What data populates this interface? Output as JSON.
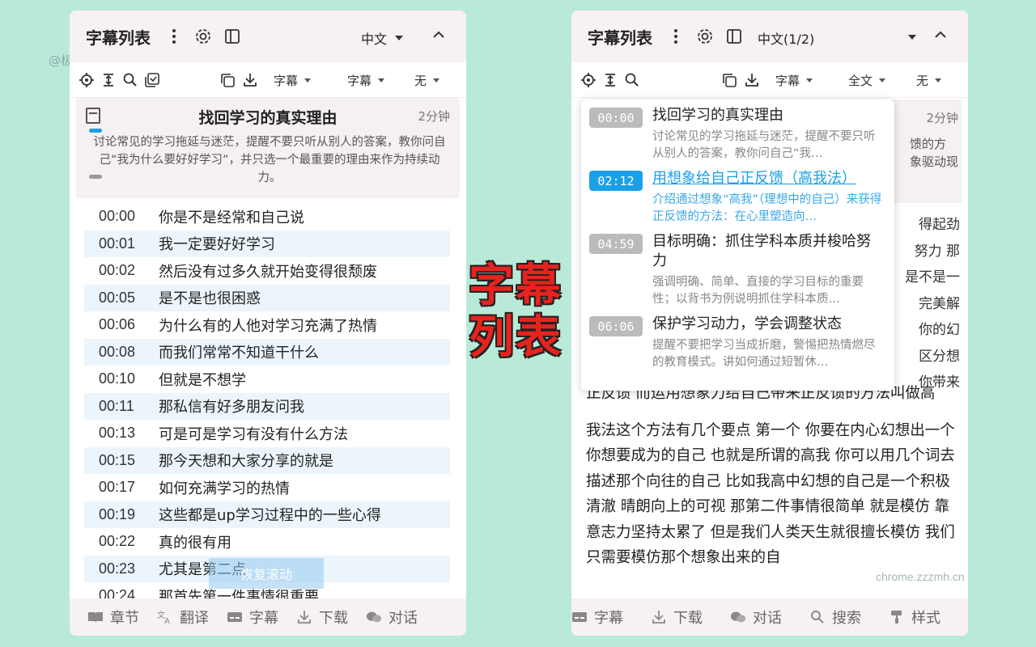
{
  "watermark_left": "@极简插件",
  "watermark_right": "chrome.zzzmh.cn",
  "center_label": [
    "字幕",
    "列表"
  ],
  "left": {
    "header": {
      "title": "字幕列表",
      "lang": "中文"
    },
    "toolbar": {
      "dropdowns": [
        "字幕",
        "字幕",
        "无"
      ]
    },
    "chapter": {
      "title": "找回学习的真实理由",
      "duration": "2分钟",
      "desc": "讨论常见的学习拖延与迷茫，提醒不要只听从别人的答案，教你问自己“我为什么要好好学习”，并只选一个最重要的理由来作为持续动力。"
    },
    "subtitles": [
      {
        "time": "00:00",
        "text": "你是不是经常和自己说"
      },
      {
        "time": "00:01",
        "text": "我一定要好好学习"
      },
      {
        "time": "00:02",
        "text": "然后没有过多久就开始变得很颓废"
      },
      {
        "time": "00:05",
        "text": "是不是也很困惑"
      },
      {
        "time": "00:06",
        "text": "为什么有的人他对学习充满了热情"
      },
      {
        "time": "00:08",
        "text": "而我们常常不知道干什么"
      },
      {
        "time": "00:10",
        "text": "但就是不想学"
      },
      {
        "time": "00:11",
        "text": "那私信有好多朋友问我"
      },
      {
        "time": "00:13",
        "text": "可是可是学习有没有什么方法"
      },
      {
        "time": "00:15",
        "text": "那今天想和大家分享的就是"
      },
      {
        "time": "00:17",
        "text": "如何充满学习的热情"
      },
      {
        "time": "00:19",
        "text": "这些都是up学习过程中的一些心得"
      },
      {
        "time": "00:22",
        "text": "真的很有用"
      },
      {
        "time": "00:23",
        "text": "尤其是第二点"
      },
      {
        "time": "00:24",
        "text": "那首先第一件事情很重要"
      }
    ],
    "restore_label": "恢复滚动",
    "bottom": [
      "章节",
      "翻译",
      "字幕",
      "下载",
      "对话"
    ]
  },
  "right": {
    "header": {
      "title": "字幕列表",
      "lang": "中文(1/2)"
    },
    "toolbar": {
      "dropdowns": [
        "字幕",
        "全文",
        "无"
      ]
    },
    "card_peek": {
      "duration": "2分钟",
      "line1": "馈的方",
      "line2": "象驱动现"
    },
    "popup": [
      {
        "time": "00:00",
        "title": "找回学习的真实理由",
        "desc": "讨论常见的学习拖延与迷茫，提醒不要只听从别人的答案，教你问自己“我…",
        "active": false
      },
      {
        "time": "02:12",
        "title": "用想象给自己正反馈（高我法）",
        "desc": "介绍通过想象“高我”（理想中的自己）来获得正反馈的方法：在心里塑造向…",
        "active": true
      },
      {
        "time": "04:59",
        "title": "目标明确：抓住学科本质并梭哈努力",
        "desc": "强调明确、简单、直接的学习目标的重要性；以背书为例说明抓住学科本质…",
        "active": false
      },
      {
        "time": "06:06",
        "title": "保护学习动力，学会调整状态",
        "desc": "提醒不要把学习当成折磨，警惕把热情燃尽的教育模式。讲如何通过短暂休…",
        "active": false
      }
    ],
    "peek_lines": [
      "得起劲",
      "努力 那",
      "是不是一",
      "完美解",
      "你的幻",
      "区分想",
      "你带来"
    ],
    "para1": "正反馈 而运用想象力给自己带来正反馈的方法叫做高",
    "para2": "我法这个方法有几个要点 第一个 你要在内心幻想出一个你想要成为的自己 也就是所谓的高我 你可以用几个词去描述那个向往的自己 比如我高中幻想的自己是一个积极清澈 晴朗向上的可视 那第二件事情很简单 就是模仿 靠意志力坚持太累了 但是我们人类天生就很擅长模仿 我们只需要模仿那个想象出来的自",
    "bottom": [
      "字幕",
      "下载",
      "对话",
      "搜索",
      "样式"
    ]
  }
}
